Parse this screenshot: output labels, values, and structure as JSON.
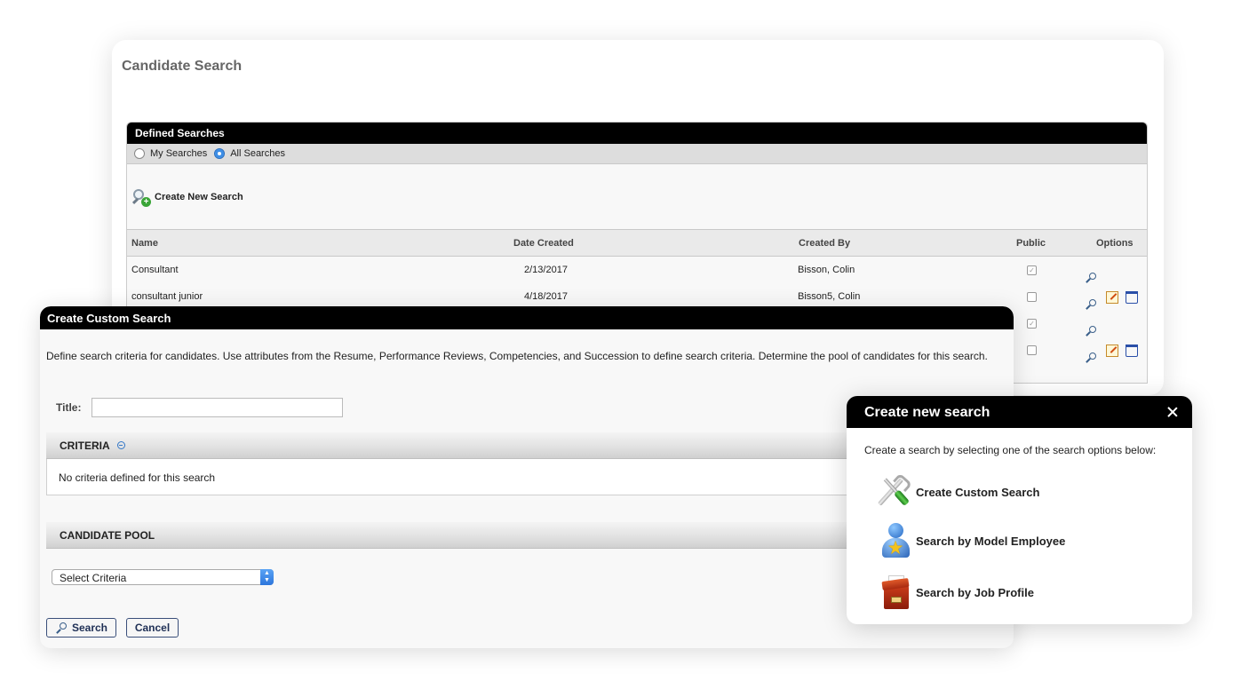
{
  "back": {
    "title": "Candidate Search",
    "defined_header": "Defined Searches",
    "radio_my": "My Searches",
    "radio_all": "All Searches",
    "create_new": "Create New Search",
    "columns": [
      "Name",
      "Date Created",
      "Created By",
      "Public",
      "Options"
    ],
    "rows": [
      {
        "name": "Consultant",
        "date": "2/13/2017",
        "by": "Bisson, Colin",
        "public": true
      },
      {
        "name": "consultant junior",
        "date": "4/18/2017",
        "by": "Bisson5, Colin",
        "public": false
      },
      {
        "name": "",
        "date": "",
        "by": "",
        "public": true
      },
      {
        "name": "",
        "date": "",
        "by": "",
        "public": false
      }
    ]
  },
  "custom": {
    "header": "Create Custom Search",
    "description": "Define search criteria for candidates. Use attributes from the Resume, Performance Reviews, Competencies, and Succession to define search criteria. Determine the pool of candidates for this search.",
    "title_label": "Title:",
    "title_value": "",
    "criteria_label": "CRITERIA",
    "no_criteria": "No criteria defined for this search",
    "pool_label": "CANDIDATE POOL",
    "select_value": "Select Criteria",
    "search_button": "Search",
    "cancel_button": "Cancel"
  },
  "modal": {
    "header": "Create new search",
    "description": "Create a search by selecting one of the search options below:",
    "options": [
      "Create Custom Search",
      "Search by Model Employee",
      "Search by Job Profile"
    ],
    "icons": [
      "tools-icon",
      "model-employee-icon",
      "job-profile-icon"
    ]
  },
  "colors": {
    "header_black": "#000000",
    "radio_selected": "#3d8ee6",
    "button_border": "#3a4f7a"
  }
}
